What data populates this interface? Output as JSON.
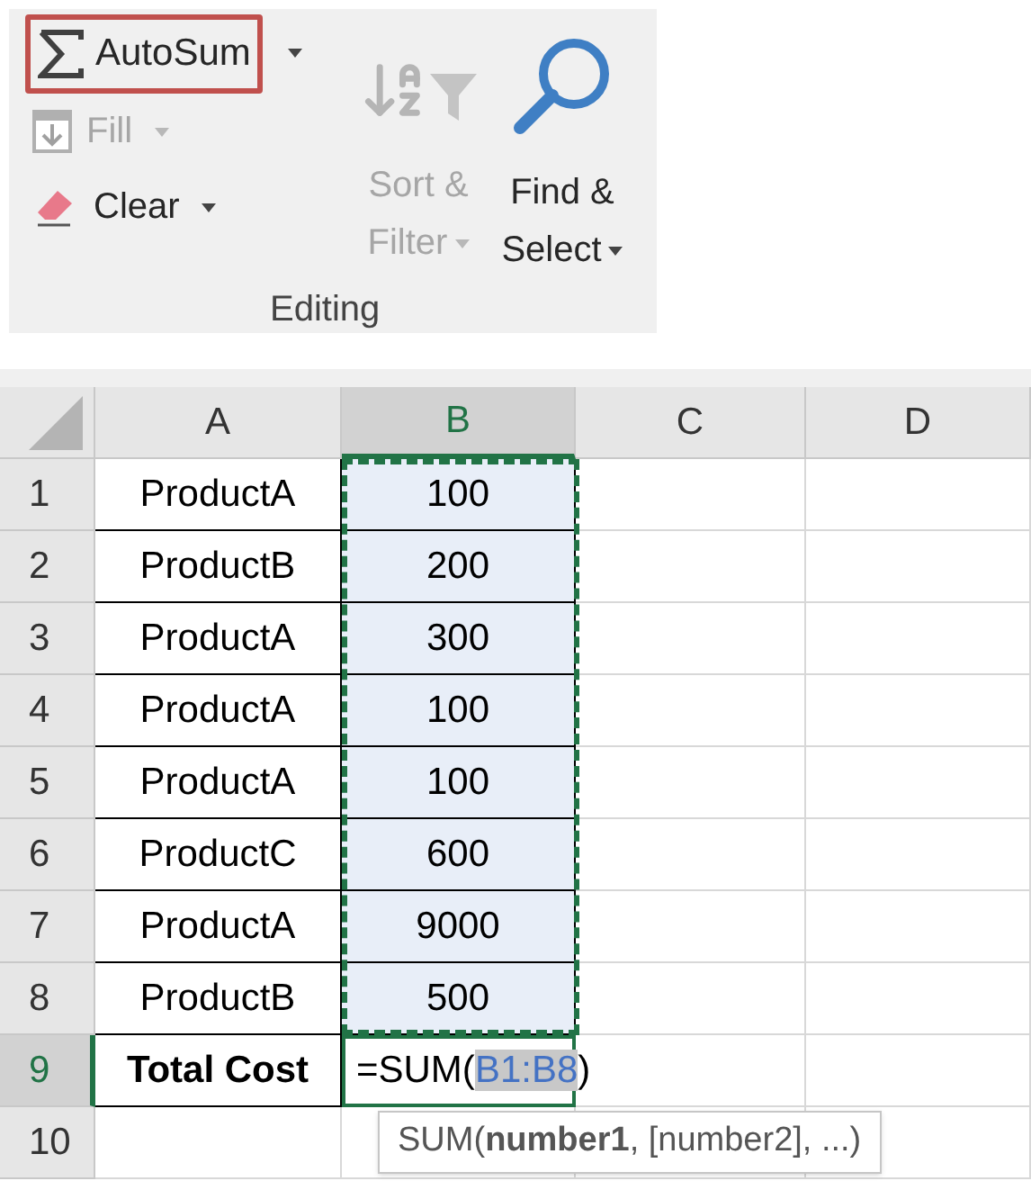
{
  "ribbon": {
    "autosum": {
      "label": "AutoSum",
      "highlighted": true
    },
    "fill": {
      "label": "Fill",
      "disabled": true
    },
    "clear": {
      "label": "Clear",
      "disabled": false
    },
    "sort_filter": {
      "lines": [
        "Sort &",
        "Filter"
      ],
      "disabled": true
    },
    "find_select": {
      "lines": [
        "Find &",
        "Select"
      ],
      "disabled": false
    },
    "group_label": "Editing"
  },
  "sheet": {
    "columns": [
      {
        "label": "A",
        "selected": false
      },
      {
        "label": "B",
        "selected": true
      },
      {
        "label": "C",
        "selected": false
      },
      {
        "label": "D",
        "selected": false
      }
    ],
    "rows": [
      {
        "header": "1",
        "selected": false,
        "in_range": true,
        "cells": [
          {
            "text": "ProductA"
          },
          {
            "text": "100"
          }
        ]
      },
      {
        "header": "2",
        "selected": false,
        "in_range": true,
        "cells": [
          {
            "text": "ProductB"
          },
          {
            "text": "200"
          }
        ]
      },
      {
        "header": "3",
        "selected": false,
        "in_range": true,
        "cells": [
          {
            "text": "ProductA"
          },
          {
            "text": "300"
          }
        ]
      },
      {
        "header": "4",
        "selected": false,
        "in_range": true,
        "cells": [
          {
            "text": "ProductA"
          },
          {
            "text": "100"
          }
        ]
      },
      {
        "header": "5",
        "selected": false,
        "in_range": true,
        "cells": [
          {
            "text": "ProductA"
          },
          {
            "text": "100"
          }
        ]
      },
      {
        "header": "6",
        "selected": false,
        "in_range": true,
        "cells": [
          {
            "text": "ProductC"
          },
          {
            "text": "600"
          }
        ]
      },
      {
        "header": "7",
        "selected": false,
        "in_range": true,
        "cells": [
          {
            "text": "ProductA"
          },
          {
            "text": "9000"
          }
        ]
      },
      {
        "header": "8",
        "selected": false,
        "in_range": true,
        "cells": [
          {
            "text": "ProductB"
          },
          {
            "text": "500"
          }
        ]
      },
      {
        "header": "9",
        "selected": true,
        "in_range": false,
        "cells": [
          {
            "text": "Total Cost",
            "bold": true
          },
          {
            "kind": "formula",
            "prefix": "=SUM(",
            "reference": "B1:B8",
            "suffix": ")"
          }
        ]
      },
      {
        "header": "10",
        "selected": false,
        "in_range": false,
        "cells": []
      }
    ],
    "tooltip": "SUM(**number1**, [number2], ...)"
  }
}
